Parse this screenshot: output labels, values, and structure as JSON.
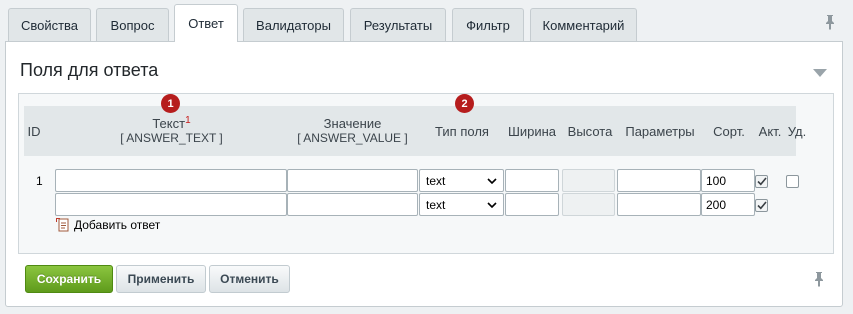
{
  "tabs": [
    {
      "label": "Свойства"
    },
    {
      "label": "Вопрос"
    },
    {
      "label": "Ответ"
    },
    {
      "label": "Валидаторы"
    },
    {
      "label": "Результаты"
    },
    {
      "label": "Фильтр"
    },
    {
      "label": "Комментарий"
    }
  ],
  "section": {
    "title": "Поля для ответа"
  },
  "table": {
    "headers": {
      "id": "ID",
      "text": "Текст",
      "text_required_mark": "1",
      "text_code": "[ ANSWER_TEXT ]",
      "value": "Значение",
      "value_code": "[ ANSWER_VALUE ]",
      "field_type": "Тип поля",
      "width": "Ширина",
      "height": "Высота",
      "params": "Параметры",
      "sort": "Сорт.",
      "active": "Акт.",
      "delete": "Уд."
    },
    "badges": [
      "1",
      "2"
    ],
    "rows": [
      {
        "id": "1",
        "text": "",
        "value": "",
        "field_type": "text",
        "width": "",
        "height": "",
        "params": "",
        "sort": "100",
        "active": true,
        "delete": false
      },
      {
        "id": "",
        "text": "",
        "value": "",
        "field_type": "text",
        "width": "",
        "height": "",
        "params": "",
        "sort": "200",
        "active": true
      }
    ],
    "add_answer_label": "Добавить ответ"
  },
  "buttons": {
    "save": "Сохранить",
    "apply": "Применить",
    "cancel": "Отменить"
  },
  "colors": {
    "badge": "#b61d1d",
    "save_button": "#6fae2a",
    "required_mark": "#c71b1b"
  },
  "icons": [
    "pin-icon",
    "collapse-icon",
    "chevron-down-icon",
    "add-answer-icon",
    "checkmark-icon"
  ]
}
